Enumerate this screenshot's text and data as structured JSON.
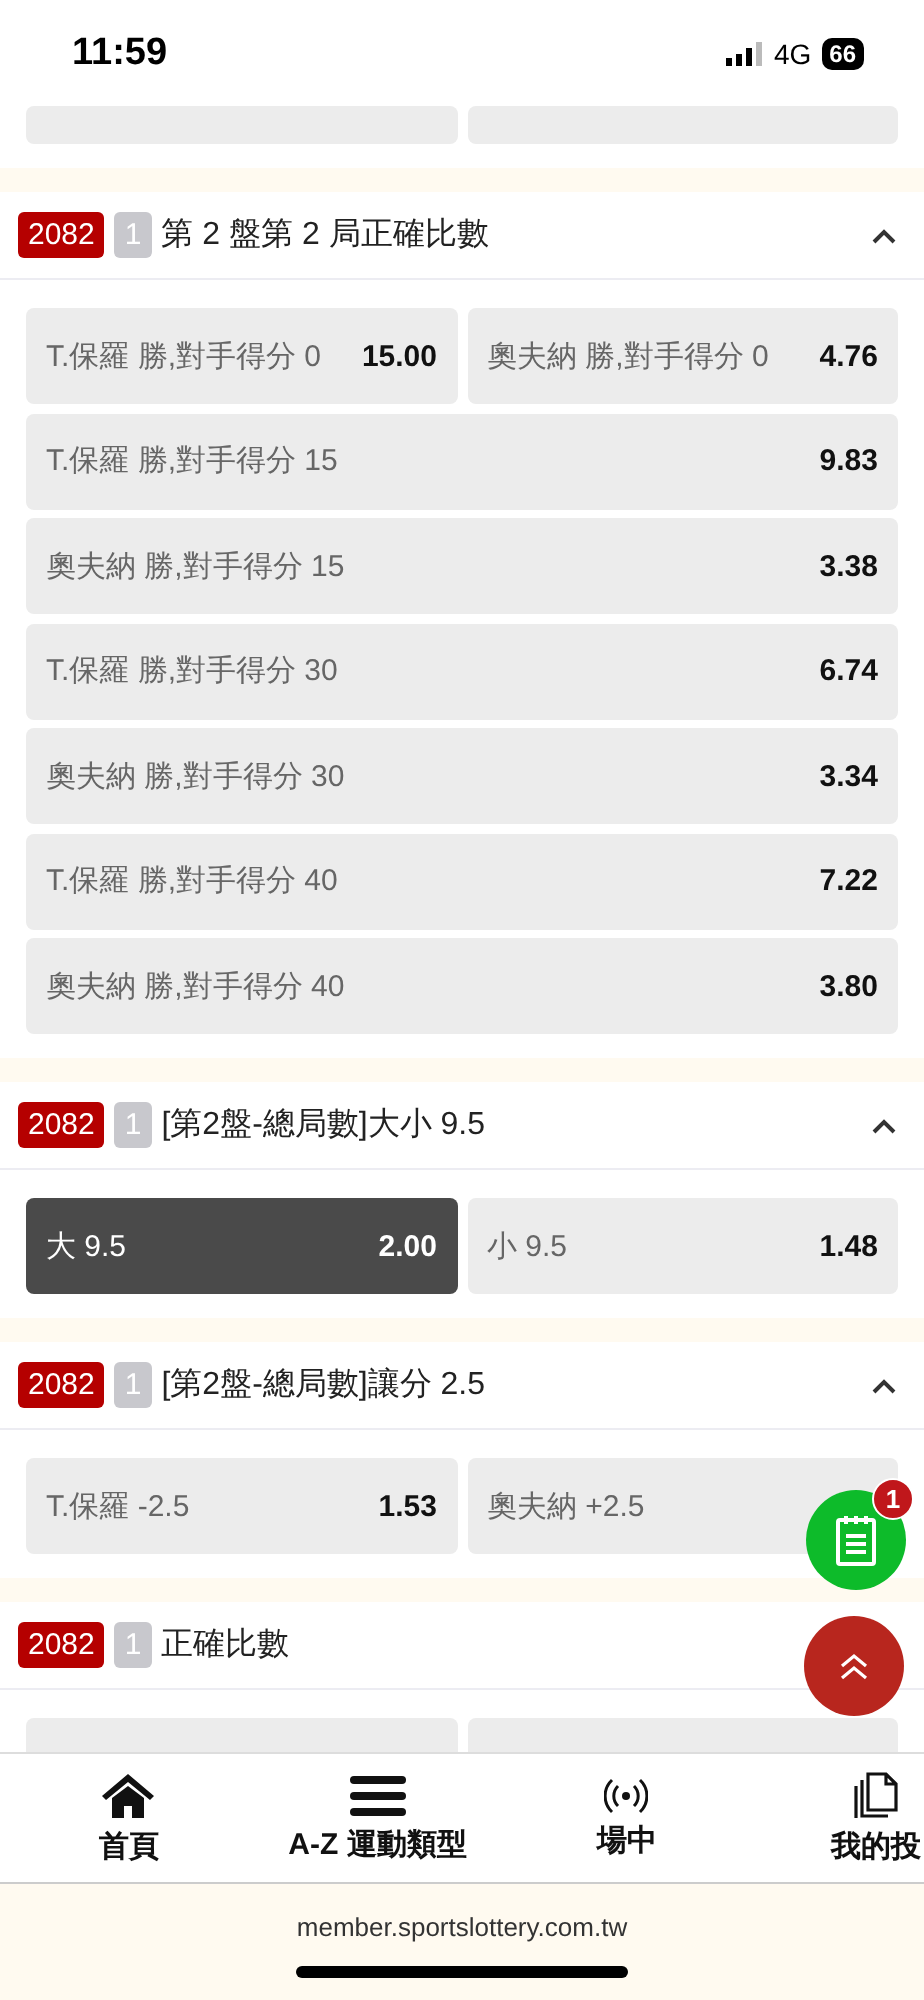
{
  "status_bar": {
    "time": "11:59",
    "network": "4G",
    "battery": "66"
  },
  "sections": [
    {
      "rows": [
        [
          {
            "selected": false
          },
          {
            "selected": false
          }
        ]
      ]
    },
    {
      "id": "2082",
      "count": "1",
      "title": "第 2 盤第 2 局正確比數",
      "expanded": true,
      "rows": [
        [
          {
            "label": "T.保羅 勝,對手得分 0",
            "odds": "15.00",
            "selected": false
          },
          {
            "label": "奧夫納 勝,對手得分 0",
            "odds": "4.76",
            "selected": false
          }
        ],
        [
          {
            "label": "T.保羅 勝,對手得分 15",
            "odds": "9.83",
            "selected": false
          }
        ],
        [
          {
            "label": "奧夫納 勝,對手得分 15",
            "odds": "3.38",
            "selected": false
          }
        ],
        [
          {
            "label": "T.保羅 勝,對手得分 30",
            "odds": "6.74",
            "selected": false
          }
        ],
        [
          {
            "label": "奧夫納 勝,對手得分 30",
            "odds": "3.34",
            "selected": false
          }
        ],
        [
          {
            "label": "T.保羅 勝,對手得分 40",
            "odds": "7.22",
            "selected": false
          }
        ],
        [
          {
            "label": "奧夫納 勝,對手得分 40",
            "odds": "3.80",
            "selected": false
          }
        ]
      ]
    },
    {
      "id": "2082",
      "count": "1",
      "title": "[第2盤-總局數]大小 9.5",
      "expanded": true,
      "rows": [
        [
          {
            "label": "大 9.5",
            "odds": "2.00",
            "selected": true
          },
          {
            "label": "小 9.5",
            "odds": "1.48",
            "selected": false
          }
        ]
      ]
    },
    {
      "id": "2082",
      "count": "1",
      "title": "[第2盤-總局數]讓分 2.5",
      "expanded": true,
      "rows": [
        [
          {
            "label": "T.保羅 -2.5",
            "odds": "1.53",
            "selected": false
          },
          {
            "label": "奧夫納 +2.5",
            "selected": false
          }
        ]
      ]
    },
    {
      "id": "2082",
      "count": "1",
      "title": "正確比數",
      "rows": [
        [
          {
            "selected": false
          },
          {
            "selected": false
          }
        ]
      ]
    }
  ],
  "bet_slip": {
    "badge": "1"
  },
  "bottom_nav": [
    {
      "label": "首頁"
    },
    {
      "label": "A-Z 運動類型"
    },
    {
      "label": "場中"
    },
    {
      "label": "我的投"
    }
  ],
  "url": "member.sportslottery.com.tw"
}
